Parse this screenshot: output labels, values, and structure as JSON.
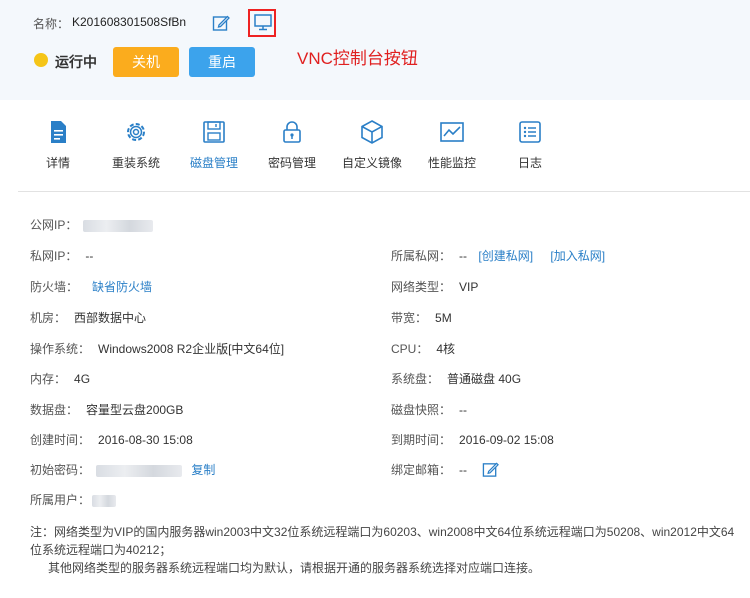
{
  "header": {
    "name_label": "名称：",
    "name_value": "K201608301508SfBn",
    "annotation": "VNC控制台按钮",
    "status": "运行中",
    "shutdown_label": "关机",
    "restart_label": "重启"
  },
  "tabs": [
    {
      "label": "详情",
      "icon": "document-icon"
    },
    {
      "label": "重装系统",
      "icon": "gear-icon"
    },
    {
      "label": "磁盘管理",
      "icon": "disk-icon"
    },
    {
      "label": "密码管理",
      "icon": "lock-icon"
    },
    {
      "label": "自定义镜像",
      "icon": "cube-icon"
    },
    {
      "label": "性能监控",
      "icon": "chart-icon"
    },
    {
      "label": "日志",
      "icon": "list-icon"
    }
  ],
  "info": {
    "public_ip_label": "公网IP：",
    "private_ip_label": "私网IP：",
    "private_ip_value": "--",
    "private_net_label": "所属私网：",
    "private_net_value": "--",
    "create_net": "[创建私网]",
    "join_net": "[加入私网]",
    "firewall_label": "防火墙：",
    "firewall_value": "缺省防火墙",
    "net_type_label": "网络类型：",
    "net_type_value": "VIP",
    "room_label": "机房：",
    "room_value": "西部数据中心",
    "bandwidth_label": "带宽：",
    "bandwidth_value": "5M",
    "os_label": "操作系统：",
    "os_value": "Windows2008 R2企业版[中文64位]",
    "cpu_label": "CPU：",
    "cpu_value": "4核",
    "mem_label": "内存：",
    "mem_value": "4G",
    "sysdisk_label": "系统盘：",
    "sysdisk_value": "普通磁盘 40G",
    "datadisk_label": "数据盘：",
    "datadisk_value": "容量型云盘200GB",
    "snapshot_label": "磁盘快照：",
    "snapshot_value": "--",
    "created_label": "创建时间：",
    "created_value": "2016-08-30 15:08",
    "expire_label": "到期时间：",
    "expire_value": "2016-09-02 15:08",
    "initpwd_label": "初始密码：",
    "copy_label": "复制",
    "email_label": "绑定邮箱：",
    "email_value": "--",
    "user_label": "所属用户："
  },
  "note": {
    "line1": "注：网络类型为VIP的国内服务器win2003中文32位系统远程端口为60203、win2008中文64位系统远程端口为50208、win2012中文64位系统远程端口为40212；",
    "line2": "其他网络类型的服务器系统远程端口均为默认，请根据开通的服务器系统选择对应端口连接。"
  }
}
